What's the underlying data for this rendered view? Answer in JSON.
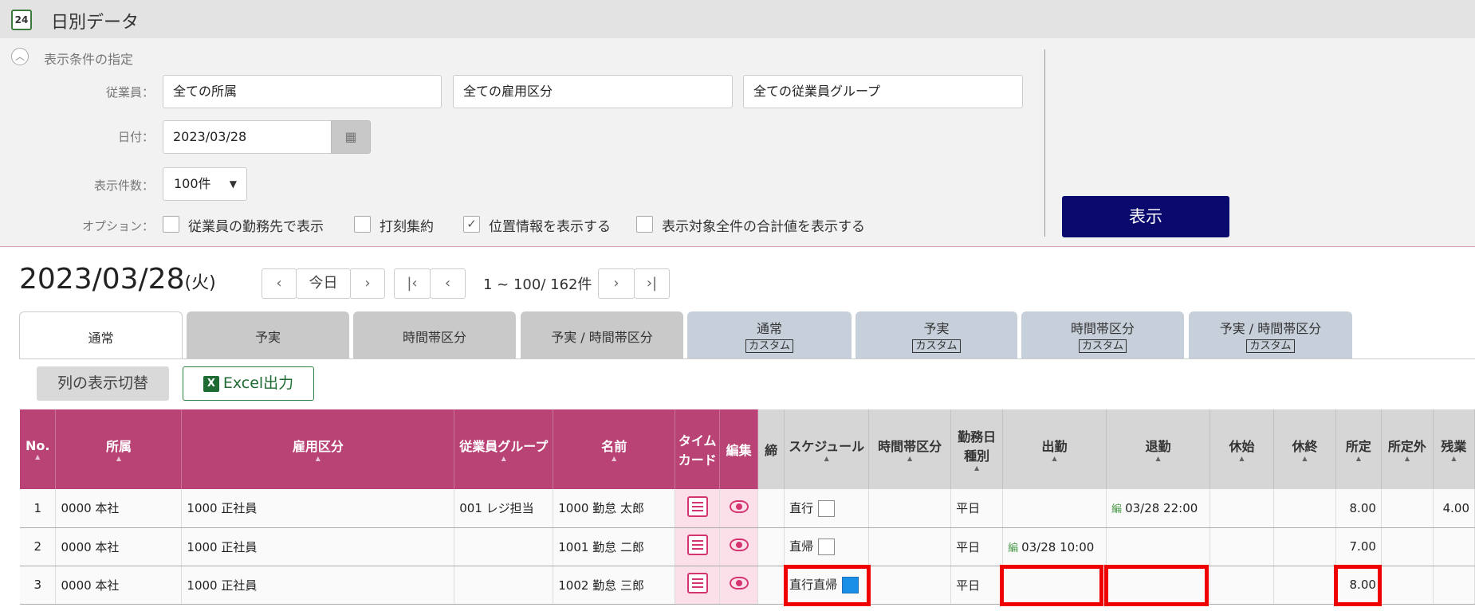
{
  "window": {
    "title": "日別データ",
    "icon_text": "24"
  },
  "filter": {
    "heading": "表示条件の指定",
    "employee_label": "従業員：",
    "employee_fields": [
      "全ての所属",
      "全ての雇用区分",
      "全ての従業員グループ"
    ],
    "date_label": "日付：",
    "date_value": "2023/03/28",
    "count_label": "表示件数：",
    "count_value": "100件",
    "options_label": "オプション：",
    "options": [
      {
        "label": "従業員の勤務先で表示",
        "checked": false
      },
      {
        "label": "打刻集約",
        "checked": false
      },
      {
        "label": "位置情報を表示する",
        "checked": true
      },
      {
        "label": "表示対象全件の合計値を表示する",
        "checked": false
      }
    ],
    "show_button": "表示"
  },
  "date_header": {
    "date": "2023/03/28",
    "weekday": "(火)"
  },
  "nav": {
    "prev": "‹",
    "today": "今日",
    "next": "›",
    "first": "|‹",
    "prev_page": "‹",
    "range": "1 ~ 100/ 162件",
    "next_page": "›",
    "last": "›|"
  },
  "tabs": [
    {
      "label": "通常",
      "sub": ""
    },
    {
      "label": "予実",
      "sub": ""
    },
    {
      "label": "時間帯区分",
      "sub": ""
    },
    {
      "label": "予実 / 時間帯区分",
      "sub": ""
    },
    {
      "label": "通常",
      "sub": "カスタム"
    },
    {
      "label": "予実",
      "sub": "カスタム"
    },
    {
      "label": "時間帯区分",
      "sub": "カスタム"
    },
    {
      "label": "予実 / 時間帯区分",
      "sub": "カスタム"
    }
  ],
  "toolbar": {
    "columns_toggle": "列の表示切替",
    "excel": "Excel出力",
    "excel_icon": "X"
  },
  "table": {
    "headers": [
      "No.",
      "所属",
      "雇用区分",
      "従業員グループ",
      "名前",
      "タイム カード",
      "編集",
      "締",
      "スケジュール",
      "時間帯区分",
      "勤務日 種別",
      "出勤",
      "退勤",
      "休始",
      "休終",
      "所定",
      "所定外",
      "残業"
    ],
    "edit_mark": "編",
    "rows": [
      {
        "no": "1",
        "dept": "0000 本社",
        "type": "1000 正社員",
        "group": "001 レジ担当",
        "name": "1000 勤怠 太郎",
        "schedule": "直行",
        "schedule_checked": false,
        "band": "",
        "daytype": "平日",
        "in": "",
        "in_edited": false,
        "out": "03/28 22:00",
        "out_edited": true,
        "bstart": "",
        "bend": "",
        "sched_hours": "8.00",
        "outside": "",
        "overtime": "4.00"
      },
      {
        "no": "2",
        "dept": "0000 本社",
        "type": "1000 正社員",
        "group": "",
        "name": "1001 勤怠 二郎",
        "schedule": "直帰",
        "schedule_checked": false,
        "band": "",
        "daytype": "平日",
        "in": "03/28 10:00",
        "in_edited": true,
        "out": "",
        "out_edited": false,
        "bstart": "",
        "bend": "",
        "sched_hours": "7.00",
        "outside": "",
        "overtime": ""
      },
      {
        "no": "3",
        "dept": "0000 本社",
        "type": "1000 正社員",
        "group": "",
        "name": "1002 勤怠 三郎",
        "schedule": "直行直帰",
        "schedule_checked": true,
        "band": "",
        "daytype": "平日",
        "in": "",
        "in_edited": false,
        "out": "",
        "out_edited": false,
        "bstart": "",
        "bend": "",
        "sched_hours": "8.00",
        "outside": "",
        "overtime": ""
      }
    ]
  },
  "colors": {
    "accent_magenta": "#b94375",
    "button_navy": "#0a0a6e",
    "highlight_red": "#ee0000",
    "excel_green": "#1d6b32"
  }
}
